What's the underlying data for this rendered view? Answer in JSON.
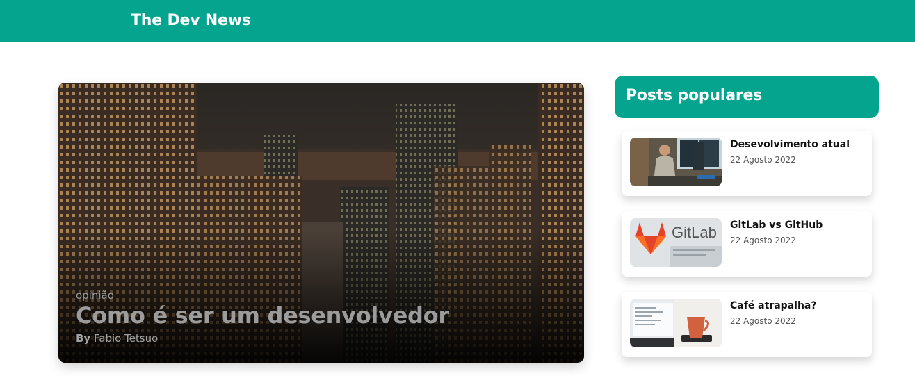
{
  "header": {
    "brand": "The Dev News",
    "color": "#04a48f"
  },
  "hero": {
    "category": "opinião",
    "title": "Como é ser um desenvolvedor",
    "author_prefix": "By",
    "author": "Fabio Tetsuo",
    "image": "city-skyline-night"
  },
  "sidebar": {
    "title": "Posts populares",
    "posts": [
      {
        "title": "Desevolvimento atual",
        "date": "22 Agosto 2022",
        "image": "person-at-desk-photo"
      },
      {
        "title": "GitLab vs GitHub",
        "date": "22 Agosto 2022",
        "image": "gitlab-logo-photo",
        "image_text": "GitLab"
      },
      {
        "title": "Café atrapalha?",
        "date": "22 Agosto 2022",
        "image": "coffee-mug-laptop-photo"
      }
    ]
  }
}
